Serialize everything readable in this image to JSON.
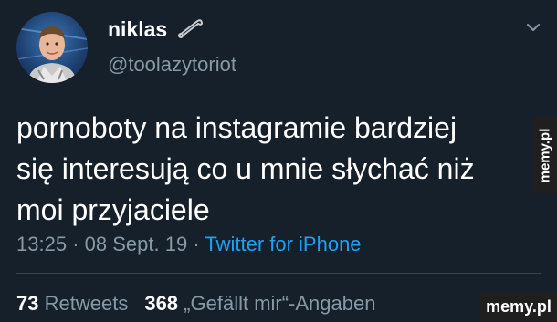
{
  "tweet": {
    "display_name": "niklas",
    "handle": "@toolazytoriot",
    "text_lines": [
      "pornoboty na instagramie bardziej",
      "się interesują co u mnie słychać niż",
      "moi przyjaciele"
    ],
    "time": "13:25",
    "separator": "·",
    "date": "08 Sept. 19",
    "source": "Twitter for iPhone"
  },
  "stats": {
    "retweets_count": "73",
    "retweets_label": "Retweets",
    "likes_count": "368",
    "likes_label": "„Gefällt mir“-Angaben"
  },
  "watermarks": {
    "side": "memy.pl",
    "corner": "memy.pl"
  },
  "icons": {
    "name_emoji": "safety-pin-icon",
    "menu": "chevron-down-icon"
  },
  "colors": {
    "background": "#15202b",
    "secondary_text": "#8899a6",
    "link": "#1da1f2",
    "divider": "#38444d"
  }
}
